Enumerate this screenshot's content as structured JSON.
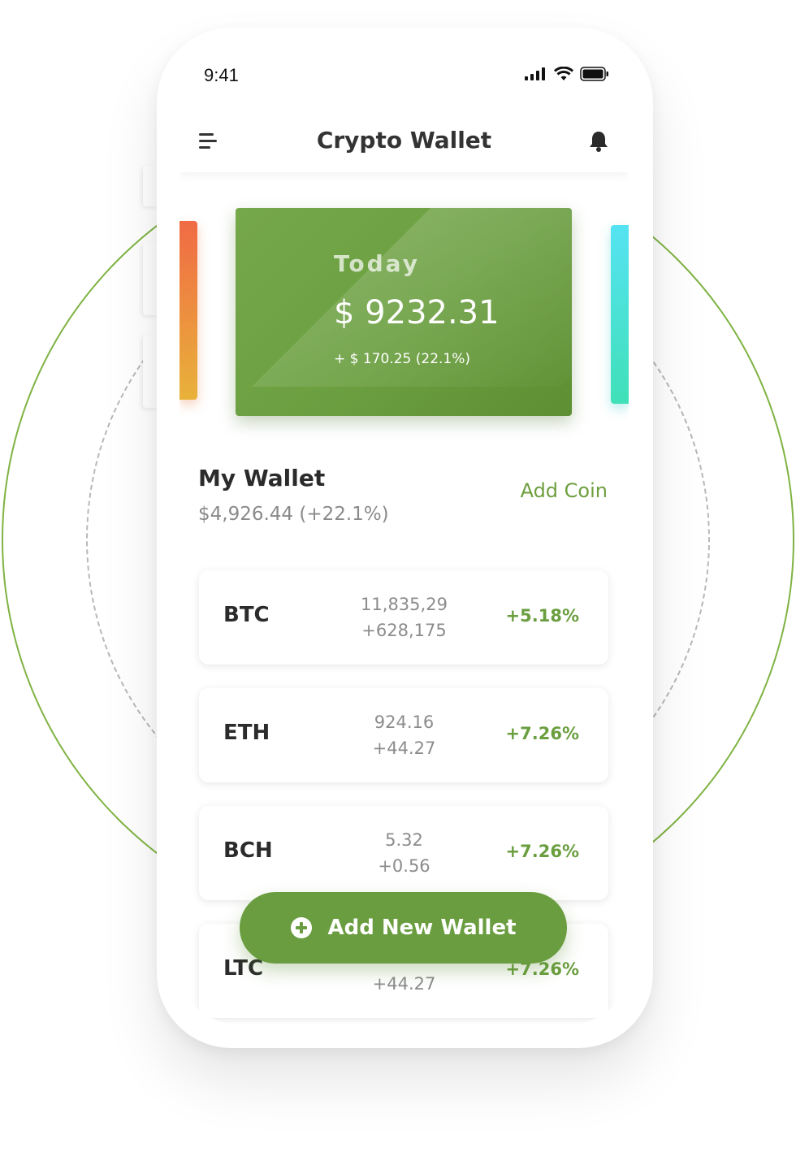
{
  "colors": {
    "brand_green": "#6a9d3f",
    "positive": "#6a9e3f",
    "card_left": "#f06a44",
    "card_right": "#55e3f2"
  },
  "status_bar": {
    "time": "9:41",
    "icons": [
      "signal-icon",
      "wifi-icon",
      "battery-icon"
    ]
  },
  "header": {
    "title": "Crypto Wallet",
    "left_icon": "menu-icon",
    "right_icon": "bell-icon"
  },
  "balance_card": {
    "label": "Today",
    "amount": "$ 9232.31",
    "change": "+ $ 170.25 (22.1%)"
  },
  "wallet": {
    "title": "My Wallet",
    "subtitle": "$4,926.44 (+22.1%)",
    "add_coin_label": "Add Coin"
  },
  "coins": [
    {
      "symbol": "BTC",
      "value": "11,835,29",
      "delta": "+628,175",
      "change": "+5.18%"
    },
    {
      "symbol": "ETH",
      "value": "924.16",
      "delta": "+44.27",
      "change": "+7.26%"
    },
    {
      "symbol": "BCH",
      "value": "5.32",
      "delta": "+0.56",
      "change": "+7.26%"
    },
    {
      "symbol": "LTC",
      "value": "",
      "delta": "+44.27",
      "change": "+7.26%"
    }
  ],
  "add_wallet": {
    "label": "Add New Wallet",
    "icon": "plus-circle-icon"
  }
}
